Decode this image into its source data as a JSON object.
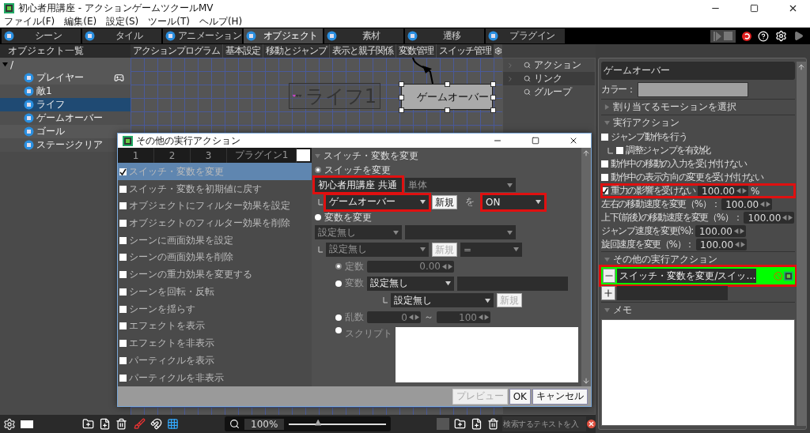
{
  "window": {
    "title": "初心者用講座 - アクションゲームツクールMV"
  },
  "menu": [
    "ファイル(F)",
    "編集(E)",
    "設定(S)",
    "ツール(T)",
    "ヘルプ(H)"
  ],
  "toolbar_tabs": [
    {
      "label": "シーン",
      "selected": false
    },
    {
      "label": "タイル",
      "selected": false
    },
    {
      "label": "アニメーション",
      "selected": false
    },
    {
      "label": "オブジェクト",
      "selected": true
    },
    {
      "label": "素材",
      "selected": false
    },
    {
      "label": "遷移",
      "selected": false
    },
    {
      "label": "プラグイン",
      "selected": false
    }
  ],
  "object_list": {
    "title": "オブジェクト一覧",
    "root": "/",
    "items": [
      {
        "label": "プレイヤー",
        "selected": false,
        "controller": true
      },
      {
        "label": "敵1",
        "selected": false,
        "controller": false
      },
      {
        "label": "ライフ",
        "selected": true,
        "controller": false
      },
      {
        "label": "ゲームオーバー",
        "selected": false,
        "controller": false
      },
      {
        "label": "ゴール",
        "selected": false,
        "controller": false
      },
      {
        "label": "ステージクリア",
        "selected": false,
        "controller": false
      }
    ]
  },
  "program_tabs": [
    "アクションプログラム",
    "基本設定",
    "移動とジャンプ",
    "表示と親子関係",
    "変数管理",
    "スイッチ管理"
  ],
  "canvas": {
    "nodes": [
      {
        "label": "ライフ1",
        "kind": "hearts",
        "selected": false
      },
      {
        "label": "ゲームオーバー",
        "kind": "plain",
        "selected": true
      }
    ],
    "zoom": "100%",
    "zoom_slider": {
      "level": 0.3
    }
  },
  "link_panel": {
    "items": [
      {
        "label": "アクション",
        "expandable": true,
        "selected": false
      },
      {
        "label": "リンク",
        "expandable": true,
        "selected": true
      },
      {
        "label": "グループ",
        "expandable": false,
        "selected": false
      }
    ],
    "search": {
      "placeholder": "検索するテキストを入"
    }
  },
  "properties": {
    "name": "ゲームオーバー",
    "color_label": "カラー：",
    "motion_section": {
      "label": "割り当てるモーションを選択",
      "expanded": false
    },
    "action_section": {
      "label": "実行アクション",
      "expanded": true
    },
    "options": [
      {
        "kind": "check",
        "label": "ジャンプ動作を行う",
        "checked": false,
        "children": [
          {
            "kind": "check",
            "label": "調整ジャンプを有効化",
            "checked": false
          }
        ]
      },
      {
        "kind": "check",
        "label": "動作中の移動の入力を受け付けない",
        "checked": false
      },
      {
        "kind": "check",
        "label": "動作中の表示方向の変更を受け付けない",
        "checked": false
      },
      {
        "kind": "check_spinner",
        "label": "重力の影響を受けない",
        "checked": true,
        "value": "100.00",
        "unit": "%",
        "highlighted": true
      },
      {
        "kind": "spinner",
        "label": "左右の移動速度を変更（%）：",
        "value": "100.00"
      },
      {
        "kind": "spinner",
        "label": "上下(前後)の移動速度を変更（%）：",
        "value": "100.00"
      },
      {
        "kind": "spinner",
        "label": "ジャンプ速度を変更(%):",
        "value": "100.00"
      },
      {
        "kind": "spinner",
        "label": "旋回速度を変更（%）：",
        "value": "100.00"
      }
    ],
    "other_section": {
      "label": "その他の実行アクション",
      "expanded": true,
      "actions": [
        {
          "label": "スイッチ・変数を変更/スイッ…",
          "highlighted": true
        }
      ]
    },
    "memo_section": {
      "label": "メモ",
      "expanded": true
    }
  },
  "dialog": {
    "title": "その他の実行アクション",
    "tabs": [
      {
        "label": "1",
        "selected": false
      },
      {
        "label": "2",
        "selected": false
      },
      {
        "label": "3",
        "selected": false
      },
      {
        "label": "プラグイン1",
        "selected": false
      }
    ],
    "actions": [
      {
        "label": "スイッチ・変数を変更",
        "checked": true,
        "selected": true
      },
      {
        "label": "スイッチ・変数を初期値に戻す",
        "checked": false,
        "selected": false
      },
      {
        "label": "オブジェクトにフィルター効果を設定",
        "checked": false,
        "selected": false
      },
      {
        "label": "オブジェクトのフィルター効果を削除",
        "checked": false,
        "selected": false
      },
      {
        "label": "シーンに画面効果を設定",
        "checked": false,
        "selected": false
      },
      {
        "label": "シーンの画面効果を削除",
        "checked": false,
        "selected": false
      },
      {
        "label": "シーンの重力効果を変更する",
        "checked": false,
        "selected": false
      },
      {
        "label": "シーンを回転・反転",
        "checked": false,
        "selected": false
      },
      {
        "label": "シーンを揺らす",
        "checked": false,
        "selected": false
      },
      {
        "label": "エフェクトを表示",
        "checked": false,
        "selected": false
      },
      {
        "label": "エフェクトを非表示",
        "checked": false,
        "selected": false
      },
      {
        "label": "パーティクルを表示",
        "checked": false,
        "selected": false
      },
      {
        "label": "パーティクルを非表示",
        "checked": false,
        "selected": false
      }
    ],
    "detail": {
      "title": "スイッチ・変数を変更",
      "switch_mode": {
        "label": "スイッチを変更",
        "selected": true
      },
      "switch_group": {
        "value": "初心者用講座 共通",
        "highlighted": true
      },
      "switch_scope": {
        "value": "単体"
      },
      "switch": {
        "value": "ゲームオーバー",
        "highlighted": true
      },
      "switch_new": "新規",
      "connector": "を",
      "switch_state": {
        "value": "ON",
        "highlighted": true
      },
      "variable_mode": {
        "label": "変数を変更",
        "selected": false
      },
      "var_group": "設定無し",
      "variable": "設定無し",
      "var_new": "新規",
      "operator": "=",
      "operands": [
        {
          "kind": "spinner",
          "label": "定数",
          "value": "0.00",
          "selected": true
        },
        {
          "kind": "select",
          "label": "変数",
          "selected": false,
          "value": "設定無し",
          "sub": "設定無し",
          "new": "新規"
        },
        {
          "kind": "range",
          "label": "乱数",
          "selected": false,
          "from": "0",
          "separator": "～",
          "to": "100"
        },
        {
          "kind": "script",
          "label": "スクリプト",
          "selected": false
        }
      ]
    },
    "buttons": [
      {
        "label": "プレビュー",
        "disabled": true
      },
      {
        "label": "OK",
        "disabled": false
      },
      {
        "label": "キャンセル",
        "disabled": false
      }
    ]
  }
}
